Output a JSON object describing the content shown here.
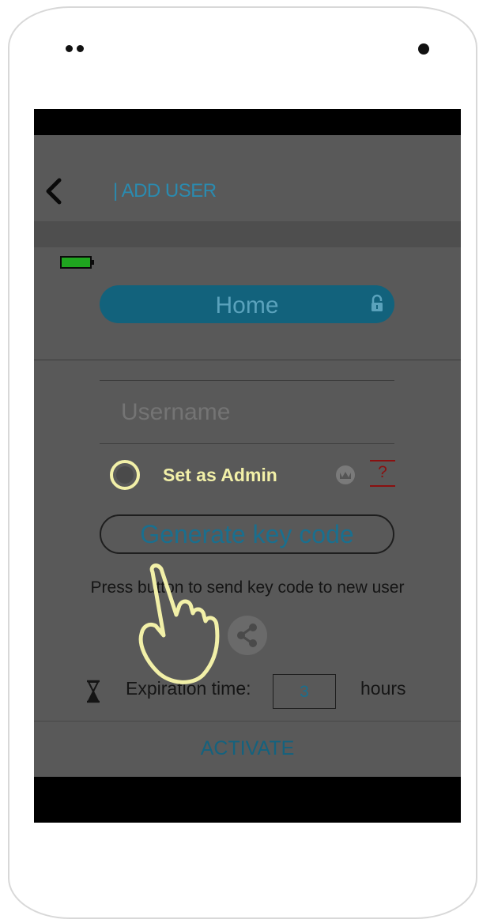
{
  "header": {
    "title": "| ADD USER"
  },
  "device": {
    "name": "Home",
    "battery_icon": "battery-full-icon",
    "lock_icon": "lock-icon"
  },
  "form": {
    "username_placeholder": "Username",
    "admin_label": "Set as Admin",
    "help_text": "?",
    "generate_label": "Generate key code",
    "hint": "Press button to send key code to new user",
    "expiration_label": "Expiration time:",
    "expiration_value": "3",
    "expiration_unit": "hours"
  },
  "footer": {
    "activate_label": "ACTIVATE"
  },
  "colors": {
    "accent": "#2a8bb0",
    "pill": "#12627c",
    "highlight": "#f2f0a8",
    "help_red": "#8a1010",
    "battery_green": "#1fa51f"
  },
  "icons": [
    "back-chevron-icon",
    "battery-full-icon",
    "lock-icon",
    "crown-icon",
    "help-icon",
    "share-icon",
    "hourglass-icon",
    "tap-hand-icon"
  ]
}
